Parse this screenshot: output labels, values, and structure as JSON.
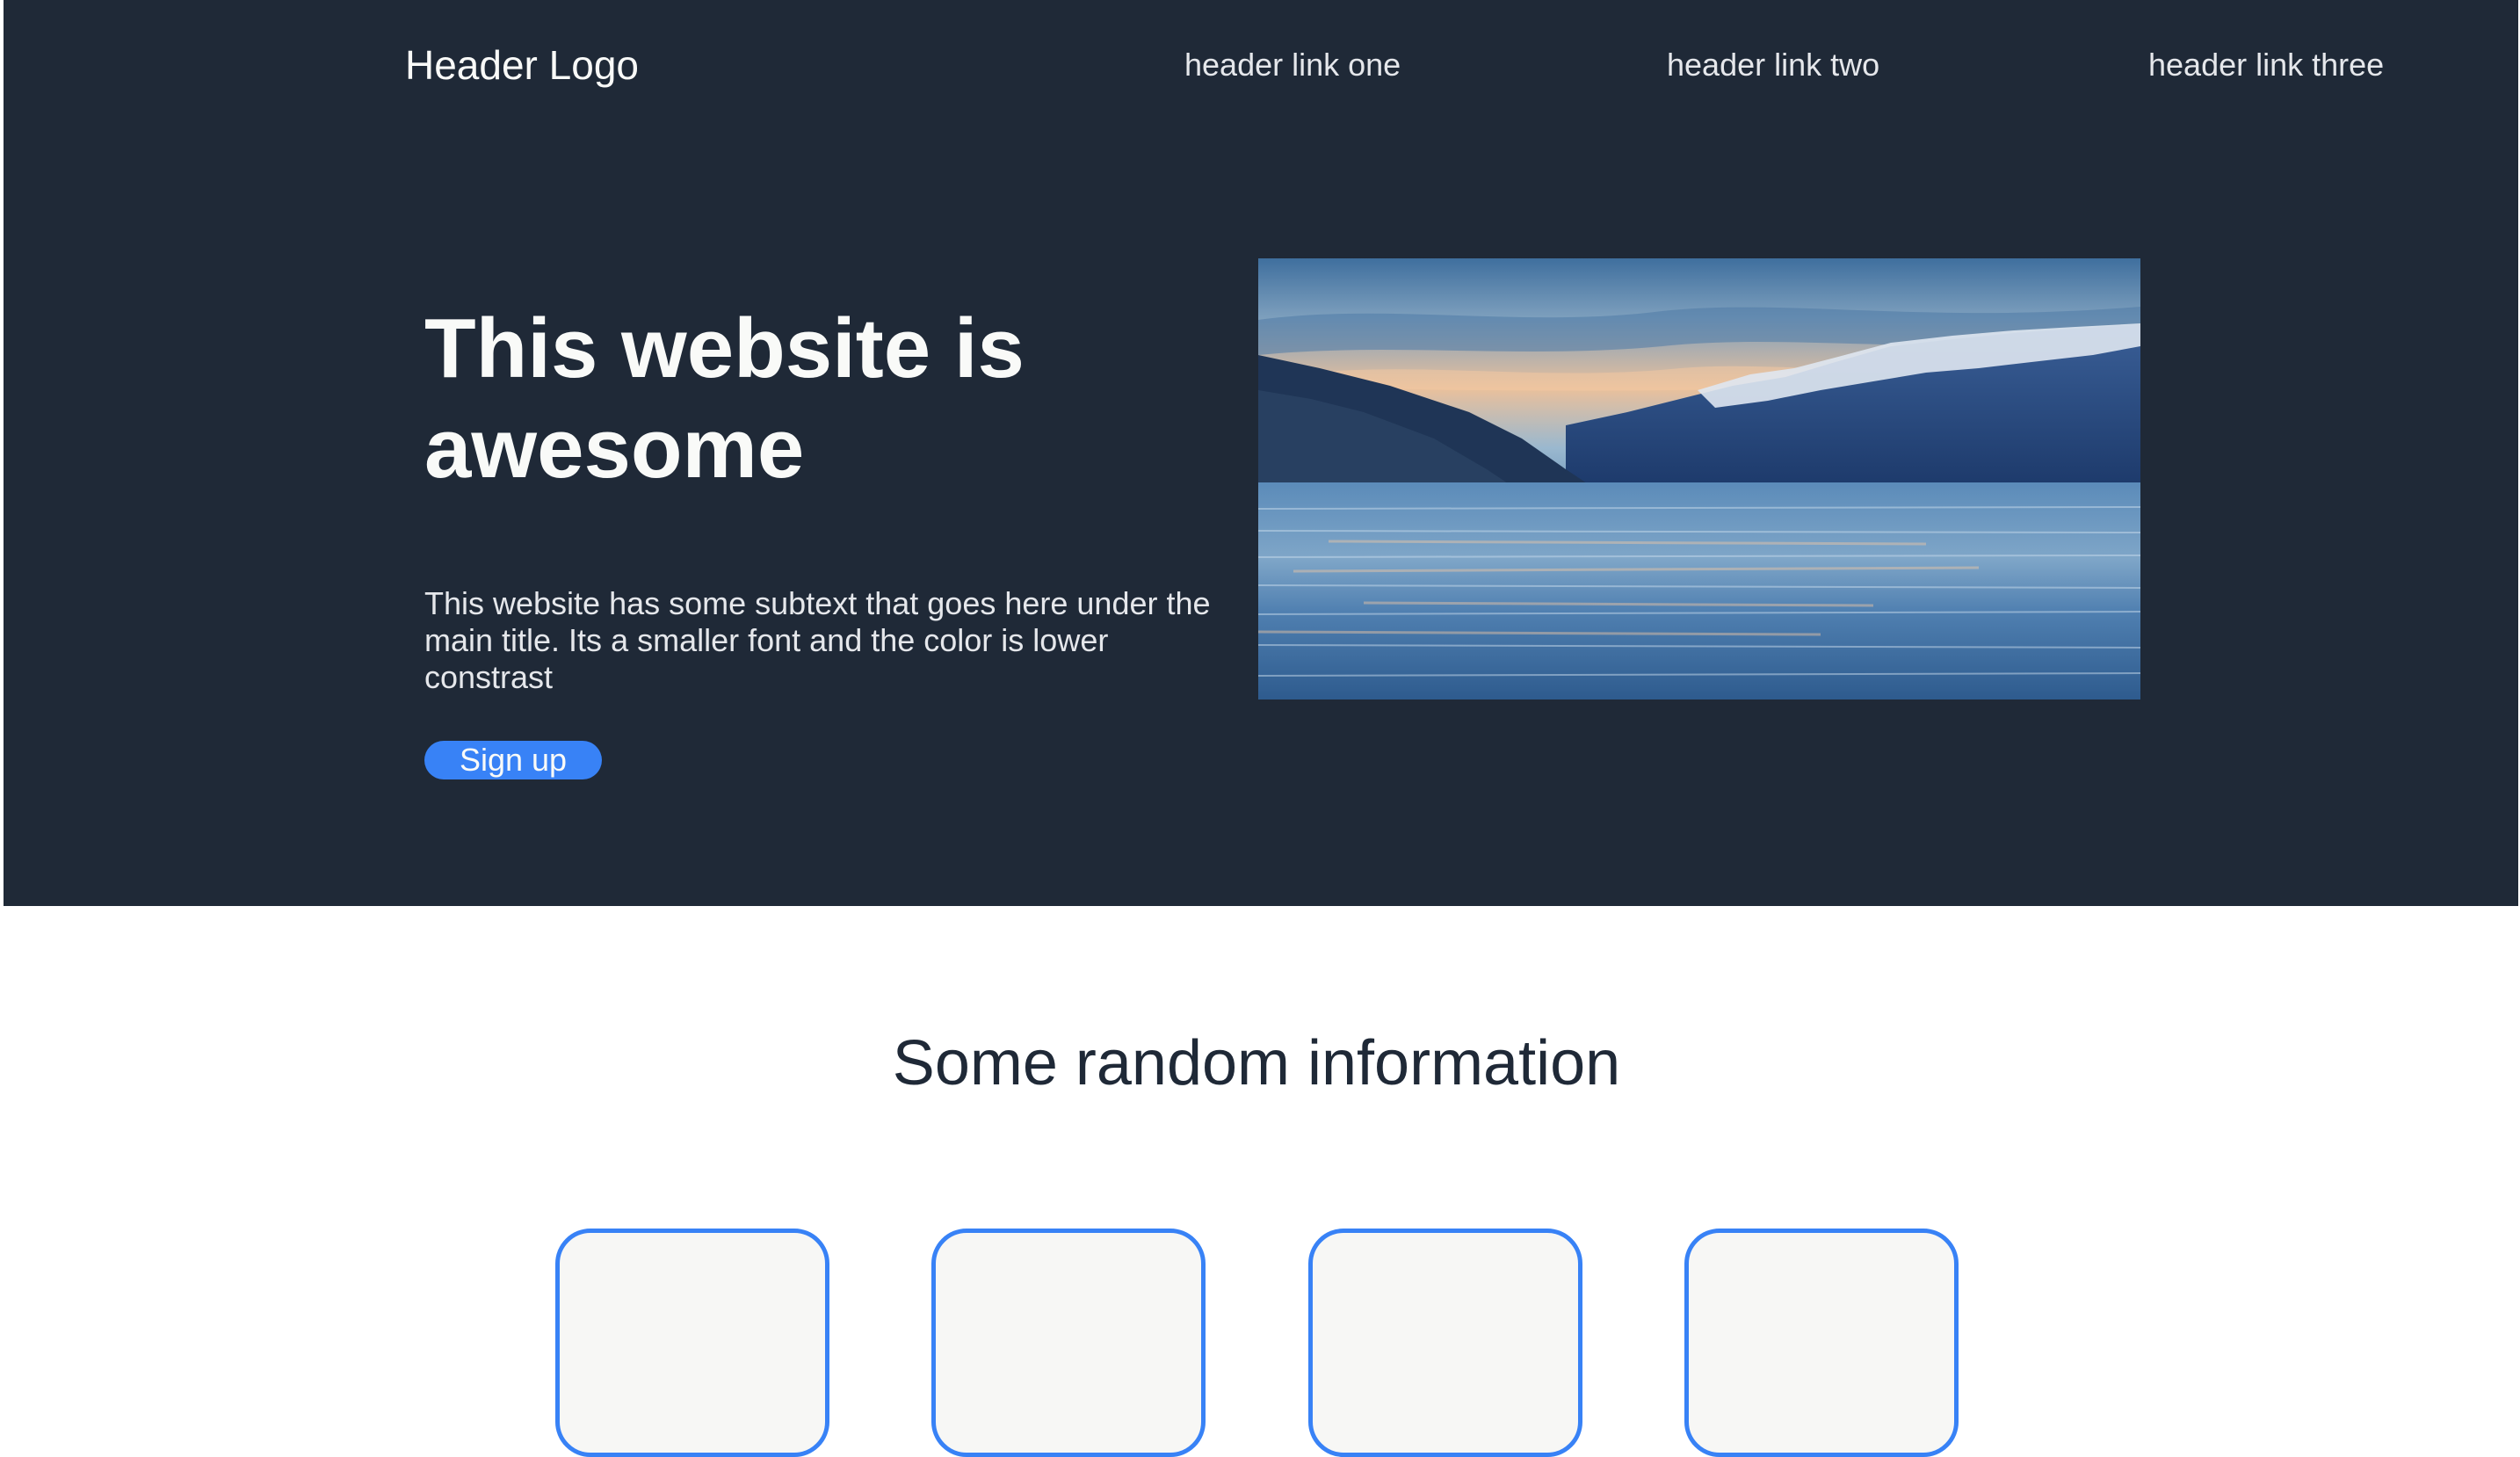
{
  "header": {
    "logo": "Header Logo",
    "links": [
      "header link one",
      "header link two",
      "header link three"
    ]
  },
  "hero": {
    "title": "This website is awesome",
    "subtext": "This website has some subtext that goes here under the main title. Its a smaller font and the color is lower constrast",
    "button_label": "Sign up",
    "image_name": "mountain-lake-sunset-image"
  },
  "info": {
    "title": "Some random information",
    "cards": [
      {},
      {},
      {},
      {}
    ]
  },
  "colors": {
    "hero_background": "#1f2937",
    "accent": "#3882f6",
    "card_background": "#f7f7f5",
    "heading_dark": "#1f2937"
  }
}
